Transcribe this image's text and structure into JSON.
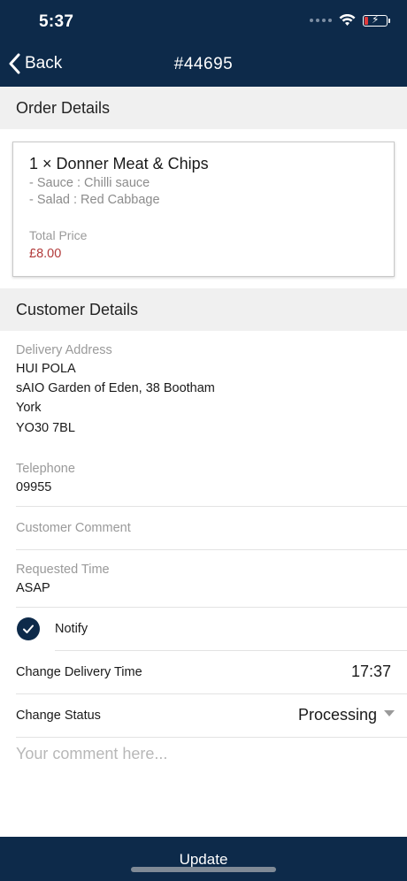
{
  "status_bar": {
    "time": "5:37",
    "icons": [
      "cellular-dots-icon",
      "wifi-icon",
      "battery-charging-icon"
    ]
  },
  "nav": {
    "back_label": "Back",
    "title": "#44695"
  },
  "order_details": {
    "header": "Order Details",
    "item_name": "1 × Donner Meat & Chips",
    "options": [
      "- Sauce : Chilli sauce",
      "- Salad : Red Cabbage"
    ],
    "total_label": "Total Price",
    "total_value": "£8.00",
    "total_color": "#b23b3b"
  },
  "customer_details": {
    "header": "Customer Details",
    "address_label": "Delivery Address",
    "address_lines": [
      "HUI POLA",
      "sAIO Garden of Eden, 38 Bootham",
      "York",
      "YO30 7BL"
    ],
    "telephone_label": "Telephone",
    "telephone_value": "09955",
    "comment_label": "Customer Comment",
    "requested_time_label": "Requested Time",
    "requested_time_value": "ASAP"
  },
  "controls": {
    "notify_label": "Notify",
    "notify_checked": true,
    "change_delivery_time_label": "Change Delivery Time",
    "delivery_time_value": "17:37",
    "change_status_label": "Change Status",
    "status_value": "Processing",
    "comment_placeholder": "Your comment here..."
  },
  "footer": {
    "update_label": "Update"
  },
  "colors": {
    "brand": "#0d2a4a",
    "section_bg": "#f0f0f0",
    "muted_text": "#9a9a9a"
  }
}
